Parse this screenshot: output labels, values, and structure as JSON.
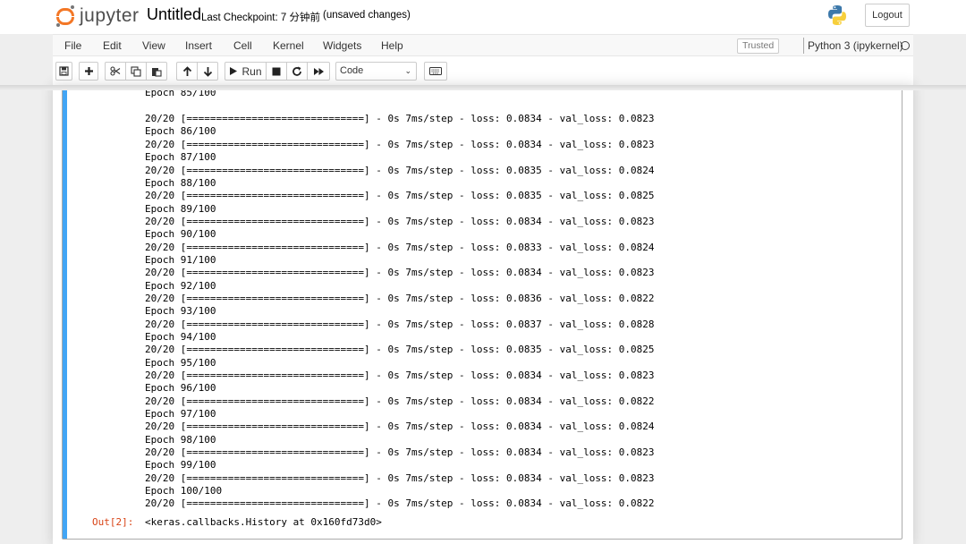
{
  "header": {
    "logo_text": "jupyter",
    "notebook_title": "Untitled",
    "checkpoint": "Last Checkpoint: 7 分钟前",
    "unsaved": "(unsaved changes)",
    "logout_label": "Logout"
  },
  "menubar": {
    "items": [
      "File",
      "Edit",
      "View",
      "Insert",
      "Cell",
      "Kernel",
      "Widgets",
      "Help"
    ],
    "trusted": "Trusted",
    "kernel_name": "Python 3 (ipykernel)"
  },
  "toolbar": {
    "run_label": "Run",
    "cell_type": "Code"
  },
  "output": {
    "lines": [
      "Epoch 85/100",
      "",
      "20/20 [==============================] - 0s 7ms/step - loss: 0.0834 - val_loss: 0.0823",
      "Epoch 86/100",
      "20/20 [==============================] - 0s 7ms/step - loss: 0.0834 - val_loss: 0.0823",
      "Epoch 87/100",
      "20/20 [==============================] - 0s 7ms/step - loss: 0.0835 - val_loss: 0.0824",
      "Epoch 88/100",
      "20/20 [==============================] - 0s 7ms/step - loss: 0.0835 - val_loss: 0.0825",
      "Epoch 89/100",
      "20/20 [==============================] - 0s 7ms/step - loss: 0.0834 - val_loss: 0.0823",
      "Epoch 90/100",
      "20/20 [==============================] - 0s 7ms/step - loss: 0.0833 - val_loss: 0.0824",
      "Epoch 91/100",
      "20/20 [==============================] - 0s 7ms/step - loss: 0.0834 - val_loss: 0.0823",
      "Epoch 92/100",
      "20/20 [==============================] - 0s 7ms/step - loss: 0.0836 - val_loss: 0.0822",
      "Epoch 93/100",
      "20/20 [==============================] - 0s 7ms/step - loss: 0.0837 - val_loss: 0.0828",
      "Epoch 94/100",
      "20/20 [==============================] - 0s 7ms/step - loss: 0.0835 - val_loss: 0.0825",
      "Epoch 95/100",
      "20/20 [==============================] - 0s 7ms/step - loss: 0.0834 - val_loss: 0.0823",
      "Epoch 96/100",
      "20/20 [==============================] - 0s 7ms/step - loss: 0.0834 - val_loss: 0.0822",
      "Epoch 97/100",
      "20/20 [==============================] - 0s 7ms/step - loss: 0.0834 - val_loss: 0.0824",
      "Epoch 98/100",
      "20/20 [==============================] - 0s 7ms/step - loss: 0.0834 - val_loss: 0.0823",
      "Epoch 99/100",
      "20/20 [==============================] - 0s 7ms/step - loss: 0.0834 - val_loss: 0.0823",
      "Epoch 100/100",
      "20/20 [==============================] - 0s 7ms/step - loss: 0.0834 - val_loss: 0.0822"
    ],
    "out_prompt": "Out[2]:",
    "out_result": "<keras.callbacks.History at 0x160fd73d0>"
  },
  "colors": {
    "logo_orange": "#f37726",
    "cell_selected_bar": "#42a5f5",
    "out_prompt": "#d84315"
  }
}
